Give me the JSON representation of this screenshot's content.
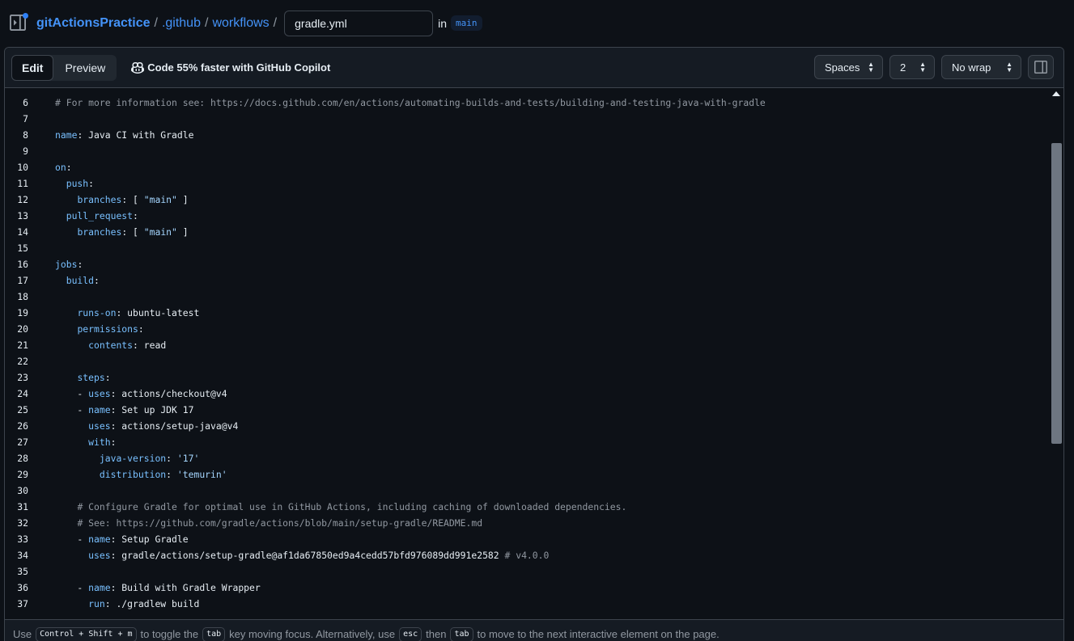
{
  "breadcrumb": {
    "repo": "gitActionsPractice",
    "folder1": ".github",
    "folder2": "workflows",
    "separator": "/",
    "filename": "gradle.yml",
    "in_label": "in",
    "branch": "main"
  },
  "toolbar": {
    "edit_label": "Edit",
    "preview_label": "Preview",
    "copilot_label": "Code 55% faster with GitHub Copilot",
    "indent_mode": "Spaces",
    "indent_size": "2",
    "wrap_mode": "No wrap"
  },
  "code": {
    "line_numbers": [
      "6",
      "7",
      "8",
      "9",
      "10",
      "11",
      "12",
      "13",
      "14",
      "15",
      "16",
      "17",
      "18",
      "19",
      "20",
      "21",
      "22",
      "23",
      "24",
      "25",
      "26",
      "27",
      "28",
      "29",
      "30",
      "31",
      "32",
      "33",
      "34",
      "35",
      "36",
      "37"
    ],
    "lines": [
      [
        {
          "t": "c",
          "v": "# For more information see: https://docs.github.com/en/actions/automating-builds-and-tests/building-and-testing-java-with-gradle"
        }
      ],
      [],
      [
        {
          "t": "k",
          "v": "name"
        },
        {
          "t": "p",
          "v": ": Java CI with Gradle"
        }
      ],
      [],
      [
        {
          "t": "k",
          "v": "on"
        },
        {
          "t": "p",
          "v": ":"
        }
      ],
      [
        {
          "t": "p",
          "v": "  "
        },
        {
          "t": "k",
          "v": "push"
        },
        {
          "t": "p",
          "v": ":"
        }
      ],
      [
        {
          "t": "p",
          "v": "    "
        },
        {
          "t": "k",
          "v": "branches"
        },
        {
          "t": "p",
          "v": ": [ "
        },
        {
          "t": "s",
          "v": "\"main\""
        },
        {
          "t": "p",
          "v": " ]"
        }
      ],
      [
        {
          "t": "p",
          "v": "  "
        },
        {
          "t": "k",
          "v": "pull_request"
        },
        {
          "t": "p",
          "v": ":"
        }
      ],
      [
        {
          "t": "p",
          "v": "    "
        },
        {
          "t": "k",
          "v": "branches"
        },
        {
          "t": "p",
          "v": ": [ "
        },
        {
          "t": "s",
          "v": "\"main\""
        },
        {
          "t": "p",
          "v": " ]"
        }
      ],
      [],
      [
        {
          "t": "k",
          "v": "jobs"
        },
        {
          "t": "p",
          "v": ":"
        }
      ],
      [
        {
          "t": "p",
          "v": "  "
        },
        {
          "t": "k",
          "v": "build"
        },
        {
          "t": "p",
          "v": ":"
        }
      ],
      [],
      [
        {
          "t": "p",
          "v": "    "
        },
        {
          "t": "k",
          "v": "runs-on"
        },
        {
          "t": "p",
          "v": ": ubuntu-latest"
        }
      ],
      [
        {
          "t": "p",
          "v": "    "
        },
        {
          "t": "k",
          "v": "permissions"
        },
        {
          "t": "p",
          "v": ":"
        }
      ],
      [
        {
          "t": "p",
          "v": "      "
        },
        {
          "t": "k",
          "v": "contents"
        },
        {
          "t": "p",
          "v": ": read"
        }
      ],
      [],
      [
        {
          "t": "p",
          "v": "    "
        },
        {
          "t": "k",
          "v": "steps"
        },
        {
          "t": "p",
          "v": ":"
        }
      ],
      [
        {
          "t": "p",
          "v": "    - "
        },
        {
          "t": "k",
          "v": "uses"
        },
        {
          "t": "p",
          "v": ": actions/checkout@v4"
        }
      ],
      [
        {
          "t": "p",
          "v": "    - "
        },
        {
          "t": "k",
          "v": "name"
        },
        {
          "t": "p",
          "v": ": Set up JDK 17"
        }
      ],
      [
        {
          "t": "p",
          "v": "      "
        },
        {
          "t": "k",
          "v": "uses"
        },
        {
          "t": "p",
          "v": ": actions/setup-java@v4"
        }
      ],
      [
        {
          "t": "p",
          "v": "      "
        },
        {
          "t": "k",
          "v": "with"
        },
        {
          "t": "p",
          "v": ":"
        }
      ],
      [
        {
          "t": "p",
          "v": "        "
        },
        {
          "t": "k",
          "v": "java-version"
        },
        {
          "t": "p",
          "v": ": "
        },
        {
          "t": "s",
          "v": "'17'"
        }
      ],
      [
        {
          "t": "p",
          "v": "        "
        },
        {
          "t": "k",
          "v": "distribution"
        },
        {
          "t": "p",
          "v": ": "
        },
        {
          "t": "s",
          "v": "'temurin'"
        }
      ],
      [],
      [
        {
          "t": "p",
          "v": "    "
        },
        {
          "t": "c",
          "v": "# Configure Gradle for optimal use in GitHub Actions, including caching of downloaded dependencies."
        }
      ],
      [
        {
          "t": "p",
          "v": "    "
        },
        {
          "t": "c",
          "v": "# See: https://github.com/gradle/actions/blob/main/setup-gradle/README.md"
        }
      ],
      [
        {
          "t": "p",
          "v": "    - "
        },
        {
          "t": "k",
          "v": "name"
        },
        {
          "t": "p",
          "v": ": Setup Gradle"
        }
      ],
      [
        {
          "t": "p",
          "v": "      "
        },
        {
          "t": "k",
          "v": "uses"
        },
        {
          "t": "p",
          "v": ": gradle/actions/setup-gradle@af1da67850ed9a4cedd57bfd976089dd991e2582 "
        },
        {
          "t": "c",
          "v": "# v4.0.0"
        }
      ],
      [],
      [
        {
          "t": "p",
          "v": "    - "
        },
        {
          "t": "k",
          "v": "name"
        },
        {
          "t": "p",
          "v": ": Build with Gradle Wrapper"
        }
      ],
      [
        {
          "t": "p",
          "v": "      "
        },
        {
          "t": "k",
          "v": "run"
        },
        {
          "t": "p",
          "v": ": ./gradlew build"
        }
      ]
    ]
  },
  "footer": {
    "t1": "Use",
    "k1": "Control + Shift + m",
    "t2": "to toggle the",
    "k2": "tab",
    "t3": "key moving focus. Alternatively, use",
    "k3": "esc",
    "t4": "then",
    "k4": "tab",
    "t5": "to move to the next interactive element on the page."
  },
  "colors": {
    "background": "#0d1117",
    "link": "#4493f8",
    "key": "#79c0ff",
    "string": "#a5d6ff",
    "comment": "#9198a1"
  }
}
